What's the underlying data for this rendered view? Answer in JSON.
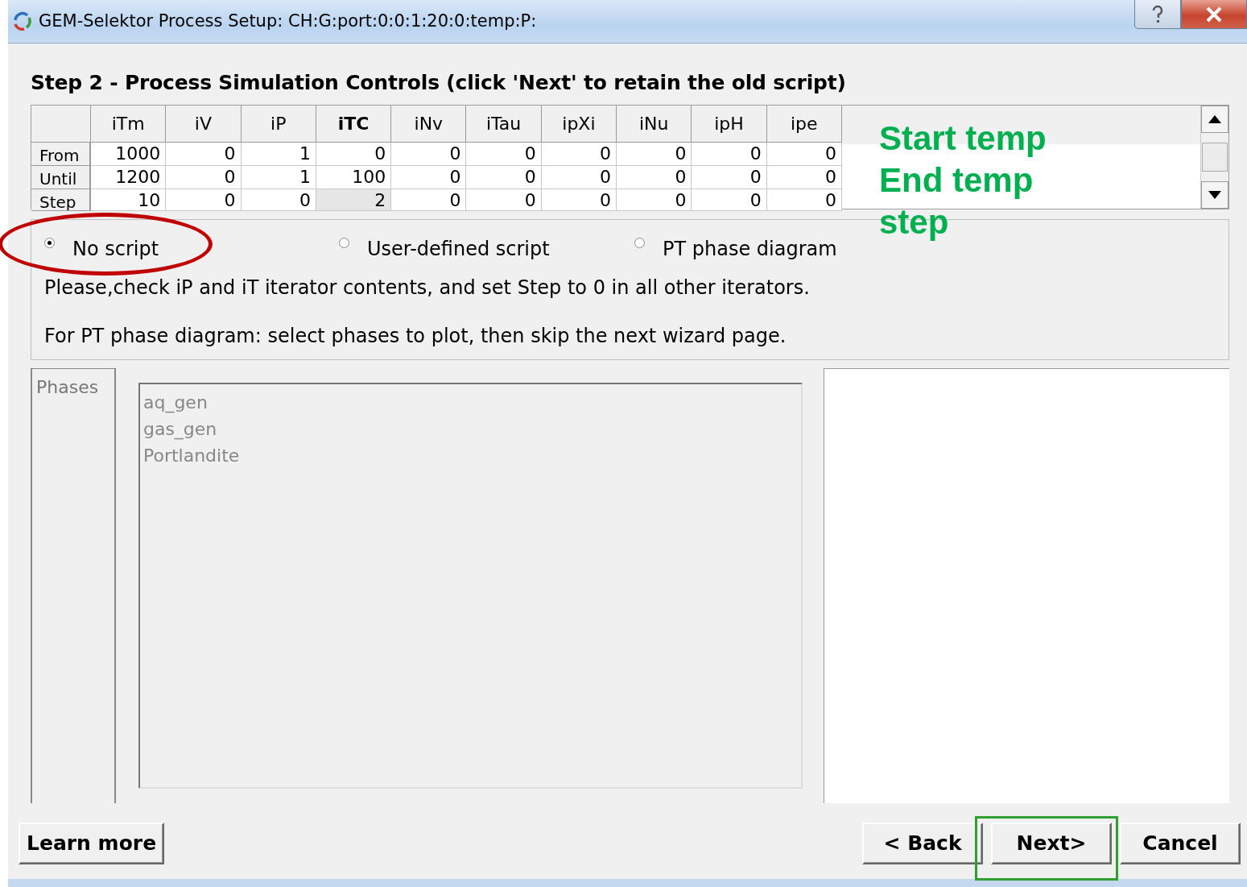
{
  "window": {
    "title": "GEM-Selektor Process Setup:  CH:G:port:0:0:1:20:0:temp:P:"
  },
  "heading": "Step 2 - Process Simulation Controls (click 'Next' to retain the old script)",
  "iterators": {
    "columns": [
      {
        "label": "iTm",
        "selected": false
      },
      {
        "label": "iV",
        "selected": false
      },
      {
        "label": "iP",
        "selected": false
      },
      {
        "label": "iTC",
        "selected": true
      },
      {
        "label": "iNv",
        "selected": false
      },
      {
        "label": "iTau",
        "selected": false
      },
      {
        "label": "ipXi",
        "selected": false
      },
      {
        "label": "iNu",
        "selected": false
      },
      {
        "label": "ipH",
        "selected": false
      },
      {
        "label": "ipe",
        "selected": false
      }
    ],
    "rows": [
      {
        "label": "From",
        "current": false,
        "values": [
          "1000",
          "0",
          "1",
          "0",
          "0",
          "0",
          "0",
          "0",
          "0",
          "0"
        ]
      },
      {
        "label": "Until",
        "current": false,
        "values": [
          "1200",
          "0",
          "1",
          "100",
          "0",
          "0",
          "0",
          "0",
          "0",
          "0"
        ]
      },
      {
        "label": "Step",
        "current": true,
        "values": [
          "10",
          "0",
          "0",
          "2",
          "0",
          "0",
          "0",
          "0",
          "0",
          "0"
        ]
      }
    ]
  },
  "script_options": [
    {
      "label": "No script",
      "selected": true
    },
    {
      "label": "User-defined script",
      "selected": false
    },
    {
      "label": "PT phase diagram",
      "selected": false
    }
  ],
  "notes": [
    "Please,check iP and iT iterator contents, and set Step to 0 in all other iterators.",
    "For PT phase diagram: select phases to plot, then skip the next wizard page."
  ],
  "phases": {
    "label": "Phases",
    "items": [
      {
        "label": "aq_gen",
        "disabled": true
      },
      {
        "label": "gas_gen",
        "disabled": true
      },
      {
        "label": "Portlandite",
        "disabled": true
      }
    ]
  },
  "buttons": {
    "left": [
      "Learn more"
    ],
    "right": [
      "< Back",
      "Next>",
      "Cancel"
    ]
  },
  "annotations": [
    {
      "kind": "ellipse"
    },
    {
      "kind": "text",
      "lines": [
        "Start temp",
        "End temp",
        "step"
      ]
    },
    {
      "kind": "box"
    }
  ]
}
